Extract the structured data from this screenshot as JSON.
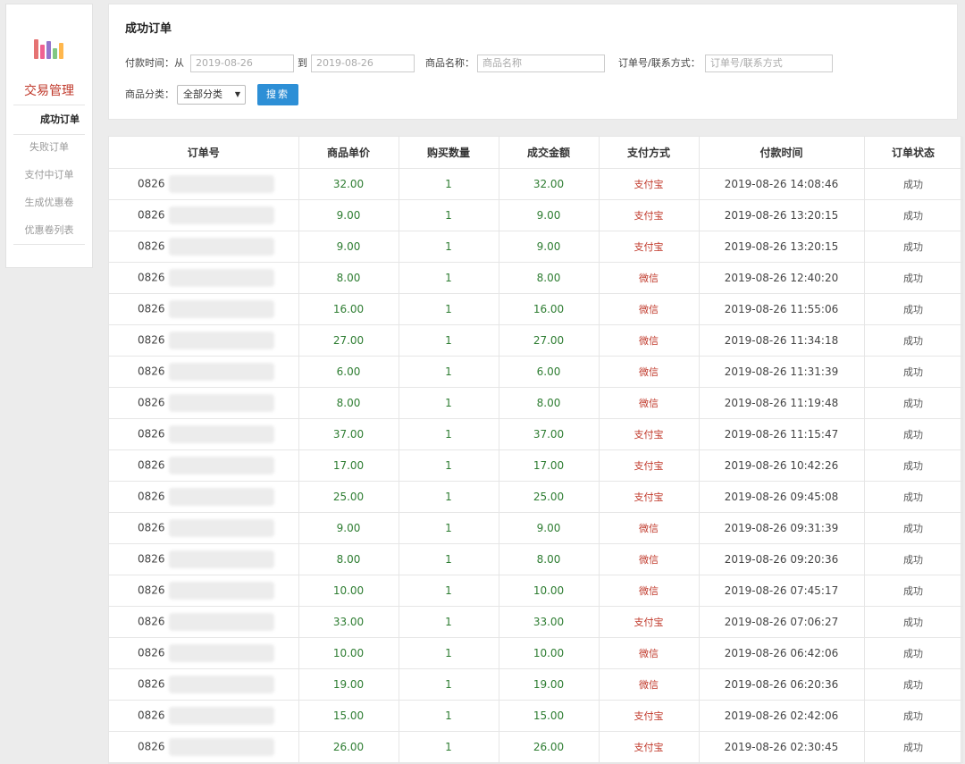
{
  "sidebar": {
    "section_title": "交易管理",
    "items": [
      {
        "label": "成功订单",
        "active": true
      },
      {
        "label": "失败订单",
        "active": false
      },
      {
        "label": "支付中订单",
        "active": false
      },
      {
        "label": "生成优惠卷",
        "active": false
      },
      {
        "label": "优惠卷列表",
        "active": false
      }
    ],
    "logo_icon": "bar-chart-icon"
  },
  "filter": {
    "title": "成功订单",
    "pay_time_label": "付款时间：从",
    "date_from": "2019-08-26",
    "to_label": "到",
    "date_to": "2019-08-26",
    "product_name_label": "商品名称：",
    "product_name_placeholder": "商品名称",
    "order_contact_label": "订单号/联系方式：",
    "order_contact_placeholder": "订单号/联系方式",
    "category_label": "商品分类：",
    "category_value": "全部分类",
    "search_label": "搜索"
  },
  "table": {
    "columns": [
      "订单号",
      "商品单价",
      "购买数量",
      "成交金额",
      "支付方式",
      "付款时间",
      "订单状态"
    ],
    "rows": [
      {
        "order": "0826",
        "price": "32.00",
        "qty": "1",
        "amount": "32.00",
        "pay": "支付宝",
        "time": "2019-08-26 14:08:46",
        "status": "成功"
      },
      {
        "order": "0826",
        "price": "9.00",
        "qty": "1",
        "amount": "9.00",
        "pay": "支付宝",
        "time": "2019-08-26 13:20:15",
        "status": "成功"
      },
      {
        "order": "0826",
        "price": "9.00",
        "qty": "1",
        "amount": "9.00",
        "pay": "支付宝",
        "time": "2019-08-26 13:20:15",
        "status": "成功"
      },
      {
        "order": "0826",
        "price": "8.00",
        "qty": "1",
        "amount": "8.00",
        "pay": "微信",
        "time": "2019-08-26 12:40:20",
        "status": "成功"
      },
      {
        "order": "0826",
        "price": "16.00",
        "qty": "1",
        "amount": "16.00",
        "pay": "微信",
        "time": "2019-08-26 11:55:06",
        "status": "成功"
      },
      {
        "order": "0826",
        "price": "27.00",
        "qty": "1",
        "amount": "27.00",
        "pay": "微信",
        "time": "2019-08-26 11:34:18",
        "status": "成功"
      },
      {
        "order": "0826",
        "price": "6.00",
        "qty": "1",
        "amount": "6.00",
        "pay": "微信",
        "time": "2019-08-26 11:31:39",
        "status": "成功"
      },
      {
        "order": "0826",
        "price": "8.00",
        "qty": "1",
        "amount": "8.00",
        "pay": "微信",
        "time": "2019-08-26 11:19:48",
        "status": "成功"
      },
      {
        "order": "0826",
        "price": "37.00",
        "qty": "1",
        "amount": "37.00",
        "pay": "支付宝",
        "time": "2019-08-26 11:15:47",
        "status": "成功"
      },
      {
        "order": "0826",
        "price": "17.00",
        "qty": "1",
        "amount": "17.00",
        "pay": "支付宝",
        "time": "2019-08-26 10:42:26",
        "status": "成功"
      },
      {
        "order": "0826",
        "price": "25.00",
        "qty": "1",
        "amount": "25.00",
        "pay": "支付宝",
        "time": "2019-08-26 09:45:08",
        "status": "成功"
      },
      {
        "order": "0826",
        "price": "9.00",
        "qty": "1",
        "amount": "9.00",
        "pay": "微信",
        "time": "2019-08-26 09:31:39",
        "status": "成功"
      },
      {
        "order": "0826",
        "price": "8.00",
        "qty": "1",
        "amount": "8.00",
        "pay": "微信",
        "time": "2019-08-26 09:20:36",
        "status": "成功"
      },
      {
        "order": "0826",
        "price": "10.00",
        "qty": "1",
        "amount": "10.00",
        "pay": "微信",
        "time": "2019-08-26 07:45:17",
        "status": "成功"
      },
      {
        "order": "0826",
        "price": "33.00",
        "qty": "1",
        "amount": "33.00",
        "pay": "支付宝",
        "time": "2019-08-26 07:06:27",
        "status": "成功"
      },
      {
        "order": "0826",
        "price": "10.00",
        "qty": "1",
        "amount": "10.00",
        "pay": "微信",
        "time": "2019-08-26 06:42:06",
        "status": "成功"
      },
      {
        "order": "0826",
        "price": "19.00",
        "qty": "1",
        "amount": "19.00",
        "pay": "微信",
        "time": "2019-08-26 06:20:36",
        "status": "成功"
      },
      {
        "order": "0826",
        "price": "15.00",
        "qty": "1",
        "amount": "15.00",
        "pay": "支付宝",
        "time": "2019-08-26 02:42:06",
        "status": "成功"
      },
      {
        "order": "0826",
        "price": "26.00",
        "qty": "1",
        "amount": "26.00",
        "pay": "支付宝",
        "time": "2019-08-26 02:30:45",
        "status": "成功"
      }
    ]
  },
  "colors": {
    "accent_red": "#c0392b",
    "value_green": "#2e7d32",
    "button_blue": "#2d8fd6"
  }
}
